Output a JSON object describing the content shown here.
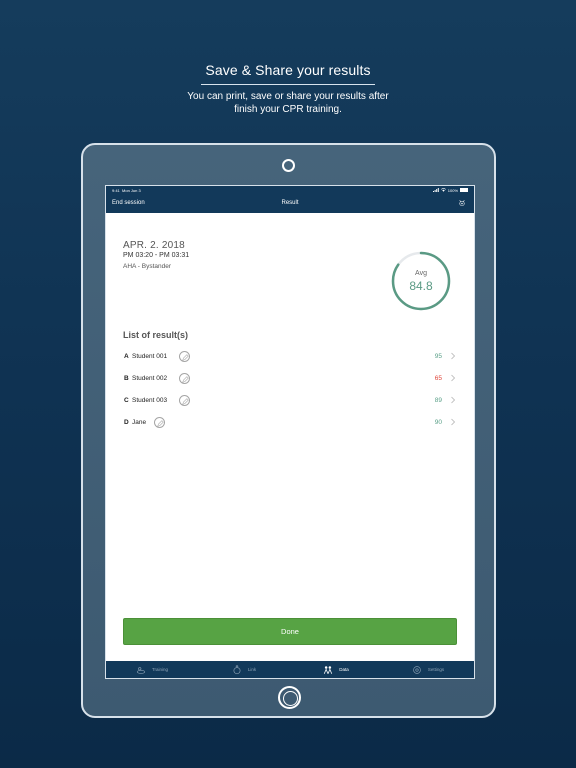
{
  "promo": {
    "title": "Save & Share your results",
    "subtitle_line1": "You can print, save or share your results after",
    "subtitle_line2": "finish your CPR training."
  },
  "status_bar": {
    "time": "9:41",
    "date": "Mon Jun 3",
    "battery": "100%"
  },
  "nav": {
    "left_label": "End session",
    "title": "Result",
    "right_icon": "share-settings-icon"
  },
  "session": {
    "date": "APR. 2. 2018",
    "time_range": "PM 03:20 - PM 03:31",
    "type": "AHA - Bystander"
  },
  "average": {
    "label": "Avg",
    "value": "84.8",
    "ring_fraction": 0.848,
    "ring_color": "#5a9a84"
  },
  "results": {
    "title": "List of result(s)",
    "rows": [
      {
        "letter": "A",
        "name": "Student 001",
        "score": "95",
        "status": "good"
      },
      {
        "letter": "B",
        "name": "Student 002",
        "score": "65",
        "status": "bad"
      },
      {
        "letter": "C",
        "name": "Student 003",
        "score": "89",
        "status": "good"
      },
      {
        "letter": "D",
        "name": "Jane",
        "score": "90",
        "status": "good"
      }
    ]
  },
  "done_label": "Done",
  "tabs": [
    {
      "label": "Training",
      "icon": "training-icon",
      "active": false
    },
    {
      "label": "Link",
      "icon": "link-icon",
      "active": false
    },
    {
      "label": "Data",
      "icon": "data-icon",
      "active": true
    },
    {
      "label": "Settings",
      "icon": "settings-icon",
      "active": false
    }
  ],
  "colors": {
    "navy": "#12395a",
    "accent_green": "#57a344",
    "score_good": "#5aa088",
    "score_bad": "#e0453a"
  }
}
